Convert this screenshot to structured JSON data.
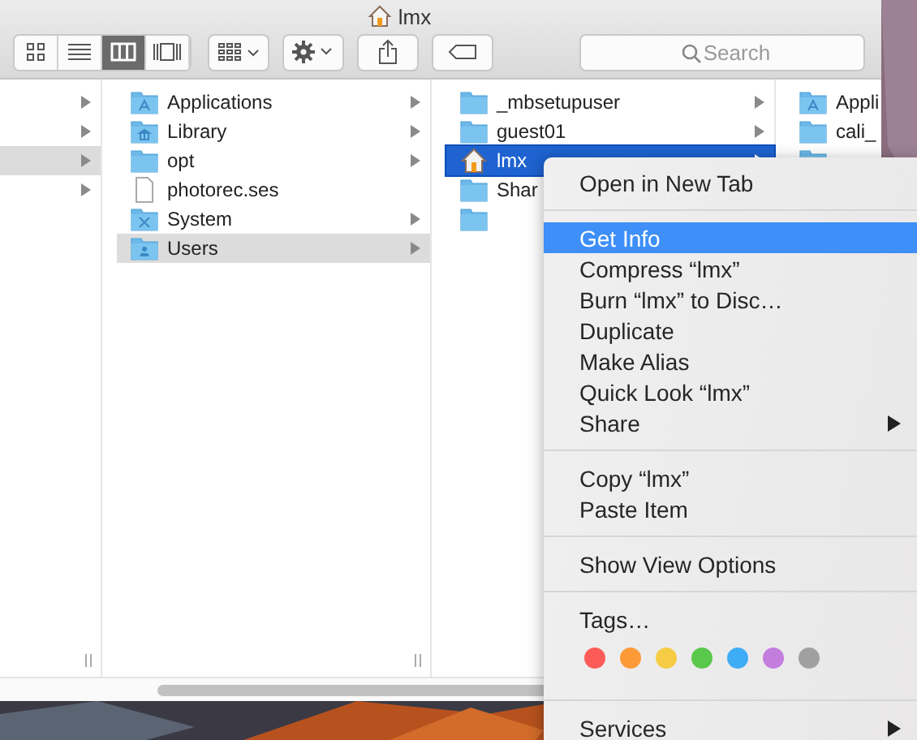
{
  "window": {
    "title": "lmx"
  },
  "toolbar": {
    "view_modes": [
      {
        "kind": "icons",
        "selected": false
      },
      {
        "kind": "list",
        "selected": false
      },
      {
        "kind": "columns",
        "selected": true
      },
      {
        "kind": "cover",
        "selected": false
      }
    ],
    "search": {
      "placeholder": "Search"
    }
  },
  "columns": [
    {
      "items": [
        {
          "kind": "none",
          "selected": false,
          "expandable": true
        },
        {
          "kind": "none",
          "selected": false,
          "expandable": true
        },
        {
          "kind": "none",
          "selected": true,
          "expandable": true
        },
        {
          "kind": "none",
          "selected": false,
          "expandable": true
        }
      ]
    },
    {
      "items": [
        {
          "label": "Applications",
          "kind": "apps",
          "selected": false,
          "expandable": true
        },
        {
          "label": "Library",
          "kind": "library",
          "selected": false,
          "expandable": true
        },
        {
          "label": "opt",
          "kind": "folder",
          "selected": false,
          "expandable": true
        },
        {
          "label": "photorec.ses",
          "kind": "file",
          "selected": false,
          "expandable": false
        },
        {
          "label": "System",
          "kind": "system",
          "selected": false,
          "expandable": true
        },
        {
          "label": "Users",
          "kind": "users",
          "selected": true,
          "expandable": true
        }
      ]
    },
    {
      "items": [
        {
          "label": "_mbsetupuser",
          "kind": "folder",
          "selected": false,
          "expandable": true
        },
        {
          "label": "guest01",
          "kind": "folder",
          "selected": false,
          "expandable": true
        },
        {
          "label": "lmx",
          "kind": "home",
          "selected": true,
          "expandable": true
        },
        {
          "label": "Shar",
          "kind": "folder",
          "selected": false
        },
        {
          "kind": "folder",
          "selected": false
        }
      ]
    },
    {
      "items": [
        {
          "label": "Appli",
          "kind": "apps",
          "selected": false
        },
        {
          "label": "cali_",
          "kind": "folder",
          "selected": false
        },
        {
          "kind": "folder",
          "selected": false
        }
      ]
    }
  ],
  "context_menu": {
    "sections": [
      {
        "kind": "items",
        "items": [
          {
            "label": "Open in New Tab",
            "selected": false,
            "submenu": false
          }
        ]
      },
      {
        "kind": "items",
        "items": [
          {
            "label": "Get Info",
            "selected": true,
            "submenu": false
          },
          {
            "label": "Compress “lmx”",
            "selected": false,
            "submenu": false
          },
          {
            "label": "Burn “lmx” to Disc…",
            "selected": false,
            "submenu": false
          },
          {
            "label": "Duplicate",
            "selected": false,
            "submenu": false
          },
          {
            "label": "Make Alias",
            "selected": false,
            "submenu": false
          },
          {
            "label": "Quick Look “lmx”",
            "selected": false,
            "submenu": false
          },
          {
            "label": "Share",
            "selected": false,
            "submenu": true
          }
        ]
      },
      {
        "kind": "items",
        "items": [
          {
            "label": "Copy “lmx”",
            "selected": false,
            "submenu": false
          },
          {
            "label": "Paste Item",
            "selected": false,
            "submenu": false
          }
        ]
      },
      {
        "kind": "items",
        "items": [
          {
            "label": "Show View Options",
            "selected": false,
            "submenu": false
          }
        ]
      },
      {
        "kind": "tags",
        "label": "Tags…",
        "tags": [
          {
            "color": "#fc5b57"
          },
          {
            "color": "#fd9a38"
          },
          {
            "color": "#f6cc45"
          },
          {
            "color": "#5ac84a"
          },
          {
            "color": "#3fadf5"
          },
          {
            "color": "#c37ddd"
          },
          {
            "color": "#a0a0a0"
          }
        ]
      },
      {
        "kind": "items",
        "items": [
          {
            "label": "Services",
            "selected": false,
            "submenu": true
          }
        ]
      }
    ]
  }
}
